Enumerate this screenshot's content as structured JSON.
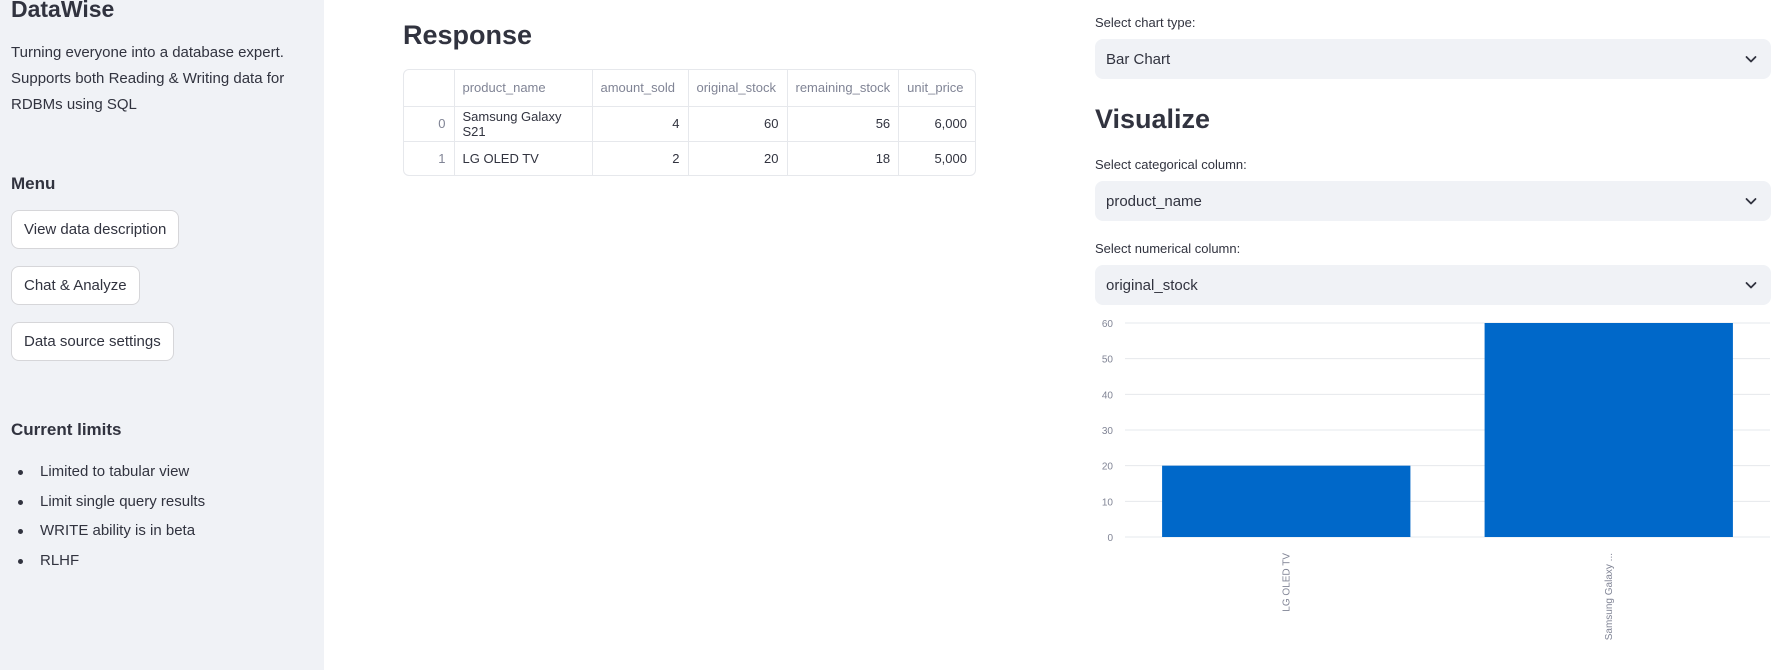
{
  "sidebar": {
    "title": "DataWise",
    "description": "Turning everyone into a database expert. Supports both Reading & Writing data for RDBMs using SQL",
    "menu_title": "Menu",
    "menu": [
      {
        "label": "View data description"
      },
      {
        "label": "Chat & Analyze"
      },
      {
        "label": "Data source settings"
      }
    ],
    "limits_title": "Current limits",
    "limits": [
      "Limited to tabular view",
      "Limit single query results",
      "WRITE ability is in beta",
      "RLHF"
    ]
  },
  "response": {
    "title": "Response",
    "columns": [
      "",
      "product_name",
      "amount_sold",
      "original_stock",
      "remaining_stock",
      "unit_price"
    ],
    "rows": [
      [
        "0",
        "Samsung Galaxy S21",
        "4",
        "60",
        "56",
        "6,000"
      ],
      [
        "1",
        "LG OLED TV",
        "2",
        "20",
        "18",
        "5,000"
      ]
    ]
  },
  "controls": {
    "chart_type_label": "Select chart type:",
    "chart_type_value": "Bar Chart",
    "visualize_title": "Visualize",
    "cat_label": "Select categorical column:",
    "cat_value": "product_name",
    "num_label": "Select numerical column:",
    "num_value": "original_stock"
  },
  "colors": {
    "bar": "#0068c9",
    "sidebar_bg": "#f0f2f6"
  },
  "chart_data": {
    "type": "bar",
    "categories": [
      "LG OLED TV",
      "Samsung Galaxy ..."
    ],
    "values": [
      20,
      60
    ],
    "ylim": [
      0,
      60
    ],
    "yticks": [
      0,
      10,
      20,
      30,
      40,
      50,
      60
    ],
    "grid": true
  }
}
